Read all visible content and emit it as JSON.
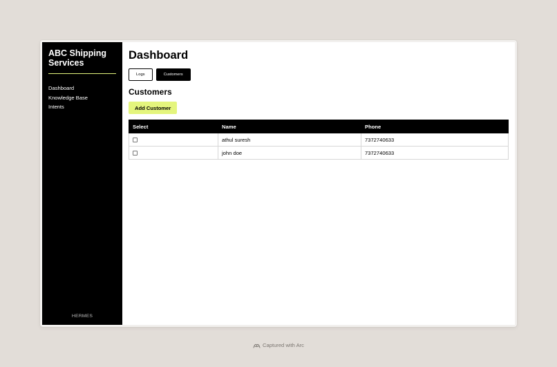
{
  "sidebar": {
    "brand": "ABC Shipping Services",
    "items": [
      {
        "label": "Dashboard"
      },
      {
        "label": "Knowledge Base"
      },
      {
        "label": "Intents"
      }
    ],
    "footer": "HERMES"
  },
  "main": {
    "title": "Dashboard",
    "tabs": [
      {
        "label": "Logs",
        "active": false
      },
      {
        "label": "Customers",
        "active": true
      }
    ],
    "section_title": "Customers",
    "add_button": "Add Customer",
    "table": {
      "columns": [
        "Select",
        "Name",
        "Phone"
      ],
      "rows": [
        {
          "selected": false,
          "name": "athul suresh",
          "phone": "7372740633"
        },
        {
          "selected": false,
          "name": "john doe",
          "phone": "7372740633"
        }
      ]
    }
  },
  "capture_label": "Captured with Arc",
  "colors": {
    "accent": "#e4f57d",
    "sidebar_bg": "#000000",
    "page_bg": "#e2ddd8"
  }
}
